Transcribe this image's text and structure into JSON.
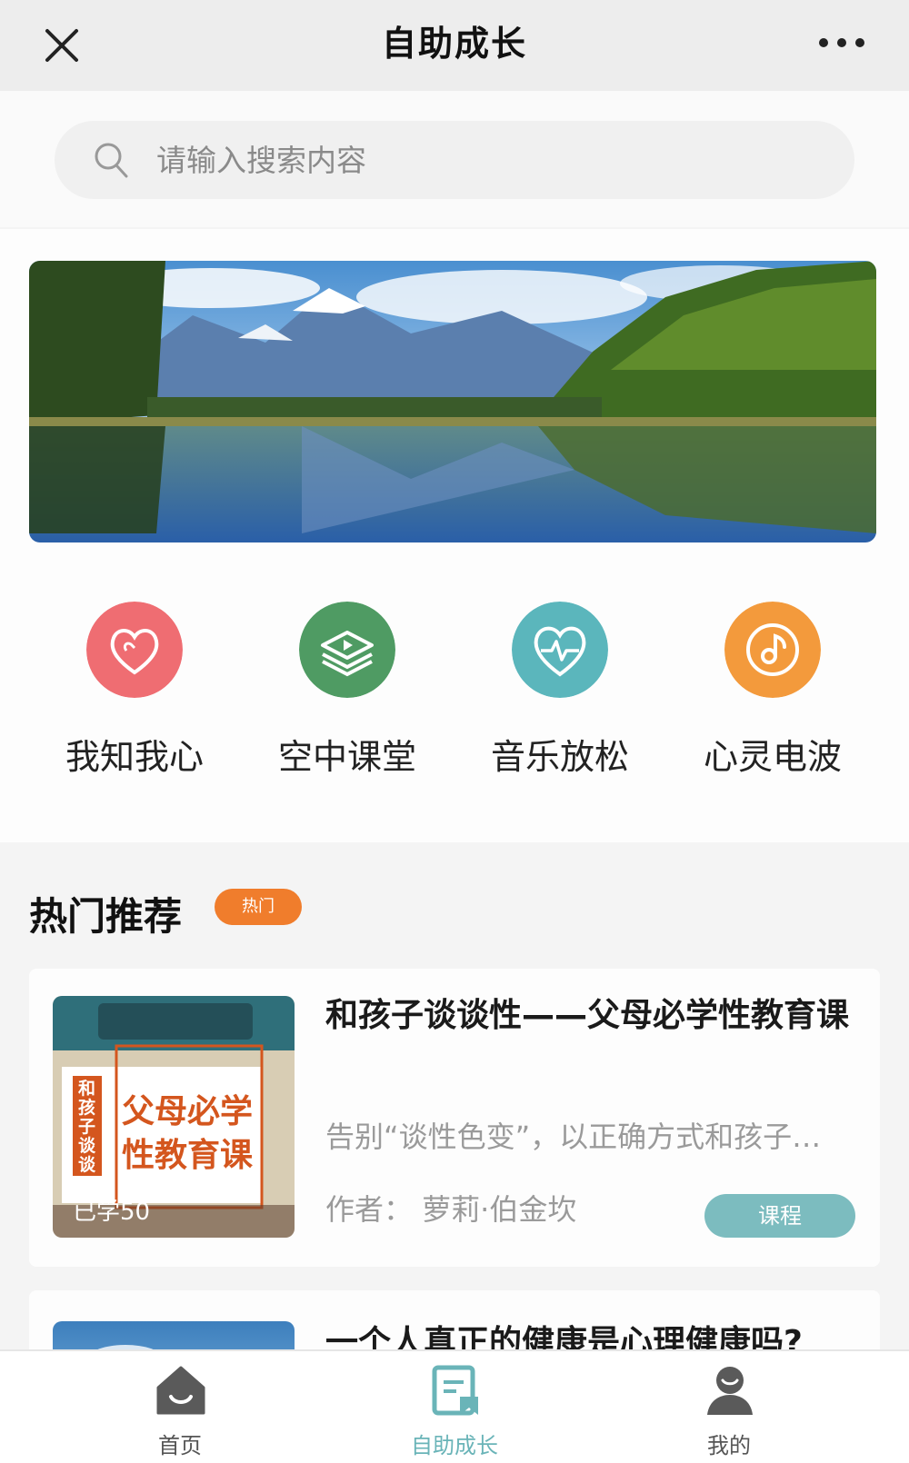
{
  "header": {
    "title": "自助成长",
    "close_icon": "close-icon",
    "more_icon": "more-dots-icon"
  },
  "search": {
    "placeholder": "请输入搜索内容",
    "icon": "search-icon"
  },
  "banner": {
    "description_icon": "mountain-lake-banner"
  },
  "shortcuts": [
    {
      "label": "我知我心",
      "icon": "heart-hands-icon",
      "color": "#ef6d72"
    },
    {
      "label": "空中课堂",
      "icon": "book-play-icon",
      "color": "#4f9b63"
    },
    {
      "label": "音乐放松",
      "icon": "heartbeat-icon",
      "color": "#5bb6bc"
    },
    {
      "label": "心灵电波",
      "icon": "music-disc-icon",
      "color": "#f39a3c"
    }
  ],
  "hot": {
    "title": "热门推荐",
    "badge": "热门",
    "badge_color": "#f07d2c"
  },
  "courses": [
    {
      "title": "和孩子谈谈性——父母必学性教育课",
      "description": "告别“谈性色变”，以正确方式和孩子…",
      "author": "作者：  萝莉·伯金坎",
      "tag": "课程",
      "learned": "已学50",
      "thumb_side_text": "和孩子谈谈",
      "thumb_line1": "父母必学",
      "thumb_line2": "性教育课"
    },
    {
      "title": "一个人真正的健康是心理健康吗?"
    }
  ],
  "tabs": [
    {
      "label": "首页",
      "icon": "home-icon",
      "active": false
    },
    {
      "label": "自助成长",
      "icon": "growth-book-icon",
      "active": true
    },
    {
      "label": "我的",
      "icon": "profile-icon",
      "active": false
    }
  ],
  "colors": {
    "accent": "#6ab4b8",
    "tag_bg": "#7cbcbf"
  }
}
